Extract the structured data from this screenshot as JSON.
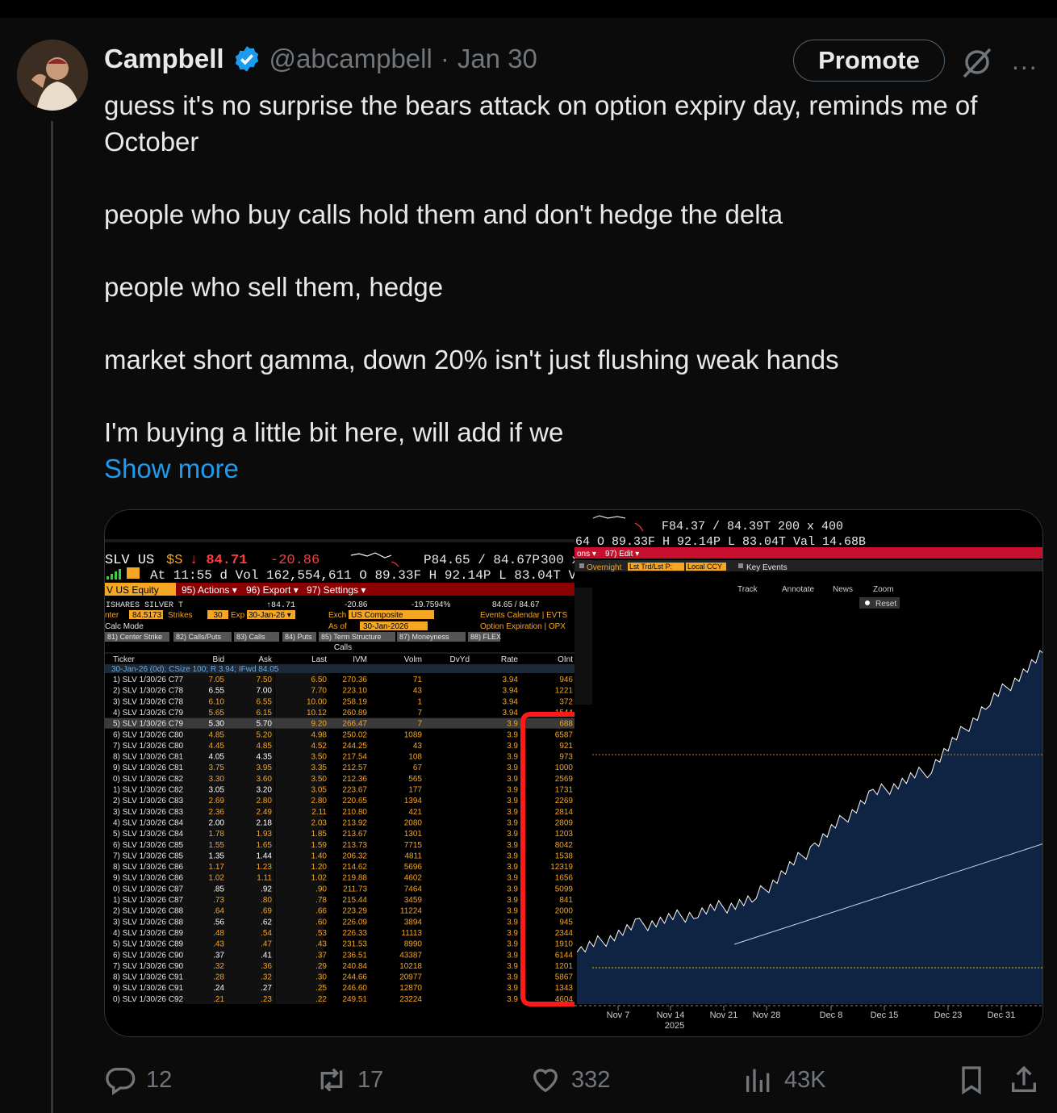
{
  "tweet": {
    "author_name": "Campbell",
    "handle": "@abcampbell",
    "separator": "·",
    "date": "Jan 30",
    "promote_label": "Promote",
    "more_icon": "...",
    "text": "guess it's no surprise the bears attack on option expiry day, reminds me of October\n\npeople who buy calls hold them and don't hedge the delta\n\npeople who sell them, hedge\n\nmarket short gamma, down 20% isn't just flushing weak hands\n\nI'm buying a little bit here, will add if we",
    "show_more": "Show more"
  },
  "bloomberg": {
    "ticker": "SLV US",
    "price": "84.71",
    "change": "-20.86",
    "bid_ask": "P84.65 / 84.67P",
    "size": "300 x",
    "at_time": "At  11:55 d  Vol  162,554,611  O  89.33F  H  92.14P  L  83.04T  Va",
    "equity_tab": "V US Equity",
    "menu_actions": "95) Actions ▾",
    "menu_export": "96) Export ▾",
    "menu_settings": "97) Settings ▾",
    "name_line": "ISHARES SILVER T",
    "name_px": "↑84.71",
    "name_chg": "-20.86",
    "name_pct": "-19.7594%",
    "name_bidask": "84.65 / 84.67",
    "center_label": "nter",
    "center_value": "84.5173",
    "strikes_label": "Strikes",
    "strikes_value": "30",
    "exp_label": "Exp",
    "exp_value": "30-Jan-26",
    "exch_label": "Exch",
    "exch_value": "US Composite",
    "asof_label": "As of",
    "asof_value": "30-Jan-2026",
    "calc_mode": "Calc Mode",
    "events_link": "Events Calendar | EVTS",
    "opx_link": "Option Expiration | OPX",
    "tabs": [
      "81) Center Strike",
      "82) Calls/Puts",
      "83) Calls",
      "84) Puts",
      "85) Term Structure",
      "87) Moneyness",
      "88) FLEX"
    ],
    "calls_label": "Calls",
    "columns": [
      "Ticker",
      "Bid",
      "Ask",
      "Last",
      "IVM",
      "Volm",
      "DvYd",
      "Rate",
      "OInt"
    ],
    "expiry_row": "30-Jan-26 (0d); CSize 100; R 3.94; IFwd 84.05",
    "rows": [
      [
        "1) SLV 1/30/26 C77",
        "7.05",
        "7.50",
        "6.50",
        "270.36",
        "71",
        "3.94",
        "946"
      ],
      [
        "2) SLV 1/30/26 C78",
        "6.55",
        "7.00",
        "7.70",
        "223.10",
        "43",
        "3.94",
        "1221"
      ],
      [
        "3) SLV 1/30/26 C78",
        "6.10",
        "6.55",
        "10.00",
        "258.19",
        "1",
        "3.94",
        "372"
      ],
      [
        "4) SLV 1/30/26 C79",
        "5.65",
        "6.15",
        "10.12",
        "260.89",
        "7",
        "3.94",
        "1544"
      ],
      [
        "5) SLV 1/30/26 C79",
        "5.30",
        "5.70",
        "9.20",
        "266.47",
        "7",
        "3.9",
        "688"
      ],
      [
        "6) SLV 1/30/26 C80",
        "4.85",
        "5.20",
        "4.98",
        "250.02",
        "1089",
        "3.9",
        "6587"
      ],
      [
        "7) SLV 1/30/26 C80",
        "4.45",
        "4.85",
        "4.52",
        "244.25",
        "43",
        "3.9",
        "921"
      ],
      [
        "8) SLV 1/30/26 C81",
        "4.05",
        "4.35",
        "3.50",
        "217.54",
        "108",
        "3.9",
        "973"
      ],
      [
        "9) SLV 1/30/26 C81",
        "3.75",
        "3.95",
        "3.35",
        "212.57",
        "67",
        "3.9",
        "1000"
      ],
      [
        "0) SLV 1/30/26 C82",
        "3.30",
        "3.60",
        "3.50",
        "212.36",
        "565",
        "3.9",
        "2569"
      ],
      [
        "1) SLV 1/30/26 C82",
        "3.05",
        "3.20",
        "3.05",
        "223.67",
        "177",
        "3.9",
        "1731"
      ],
      [
        "2) SLV 1/30/26 C83",
        "2.69",
        "2.80",
        "2.80",
        "220.65",
        "1394",
        "3.9",
        "2269"
      ],
      [
        "3) SLV 1/30/26 C83",
        "2.36",
        "2.49",
        "2.11",
        "210.80",
        "421",
        "3.9",
        "2814"
      ],
      [
        "4) SLV 1/30/26 C84",
        "2.00",
        "2.18",
        "2.03",
        "213.92",
        "2080",
        "3.9",
        "2809"
      ],
      [
        "5) SLV 1/30/26 C84",
        "1.78",
        "1.93",
        "1.85",
        "213.67",
        "1301",
        "3.9",
        "1203"
      ],
      [
        "6) SLV 1/30/26 C85",
        "1.55",
        "1.65",
        "1.59",
        "213.73",
        "7715",
        "3.9",
        "8042"
      ],
      [
        "7) SLV 1/30/26 C85",
        "1.35",
        "1.44",
        "1.40",
        "206.32",
        "4811",
        "3.9",
        "1538"
      ],
      [
        "8) SLV 1/30/26 C86",
        "1.17",
        "1.23",
        "1.20",
        "214.62",
        "5696",
        "3.9",
        "12319"
      ],
      [
        "9) SLV 1/30/26 C86",
        "1.02",
        "1.11",
        "1.02",
        "219.88",
        "4602",
        "3.9",
        "1656"
      ],
      [
        "0) SLV 1/30/26 C87",
        ".85",
        ".92",
        ".90",
        "211.73",
        "7464",
        "3.9",
        "5099"
      ],
      [
        "1) SLV 1/30/26 C87",
        ".73",
        ".80",
        ".78",
        "215.44",
        "3459",
        "3.9",
        "841"
      ],
      [
        "2) SLV 1/30/26 C88",
        ".64",
        ".69",
        ".66",
        "223.29",
        "11224",
        "3.9",
        "2000"
      ],
      [
        "3) SLV 1/30/26 C88",
        ".56",
        ".62",
        ".60",
        "226.09",
        "3894",
        "3.9",
        "945"
      ],
      [
        "4) SLV 1/30/26 C89",
        ".48",
        ".54",
        ".53",
        "226.33",
        "11113",
        "3.9",
        "2344"
      ],
      [
        "5) SLV 1/30/26 C89",
        ".43",
        ".47",
        ".43",
        "231.53",
        "8990",
        "3.9",
        "1910"
      ],
      [
        "6) SLV 1/30/26 C90",
        ".37",
        ".41",
        ".37",
        "236.51",
        "43387",
        "3.9",
        "6144"
      ],
      [
        "7) SLV 1/30/26 C90",
        ".32",
        ".36",
        ".29",
        "240.84",
        "10218",
        "3.9",
        "1201"
      ],
      [
        "8) SLV 1/30/26 C91",
        ".28",
        ".32",
        ".30",
        "244.66",
        "20977",
        "3.9",
        "5867"
      ],
      [
        "9) SLV 1/30/26 C91",
        ".24",
        ".27",
        ".25",
        "246.60",
        "12870",
        "3.9",
        "1343"
      ],
      [
        "0) SLV 1/30/26 C92",
        ".21",
        ".23",
        ".22",
        "249.51",
        "23224",
        "3.9",
        "4604"
      ]
    ],
    "chart_quote1": "F84.37 / 84.39T     200 x 400",
    "chart_quote2": "64   O  89.33F   H  92.14P   L  83.04T   Val   14.68B",
    "chart_menu1": "ons ▾",
    "chart_menu2": "97) Edit ▾",
    "overnight": "Overnight",
    "lst_trd": "Lst Trd/Lst P:",
    "local_ccy": "Local CCY",
    "key_events": "Key Events",
    "chart_tools": [
      "Track",
      "Annotate",
      "News",
      "Zoom"
    ],
    "reset": "Reset",
    "chart_axis_marker": "1",
    "x_ticks": [
      "Nov 7",
      "Nov 14",
      "Nov 21",
      "Nov 28",
      "Dec 8",
      "Dec 15",
      "Dec 23",
      "Dec 31"
    ],
    "year_label": "2025"
  },
  "engagement": {
    "replies": "12",
    "reposts": "17",
    "likes": "332",
    "views": "43K"
  },
  "colors": {
    "accent": "#1d9bf0",
    "bbg_orange": "#f5a623",
    "bbg_red": "#c8102e",
    "chart_fill": "#0f2342",
    "highlight_box": "#ff1a1a"
  },
  "chart_data": {
    "type": "area",
    "title": "",
    "x": [
      "Nov 7",
      "Nov 14",
      "Nov 21",
      "Nov 28",
      "Dec 8",
      "Dec 15",
      "Dec 23",
      "Dec 31",
      ""
    ],
    "values": [
      44,
      46,
      47,
      48,
      52,
      56,
      58,
      63,
      67
    ]
  }
}
